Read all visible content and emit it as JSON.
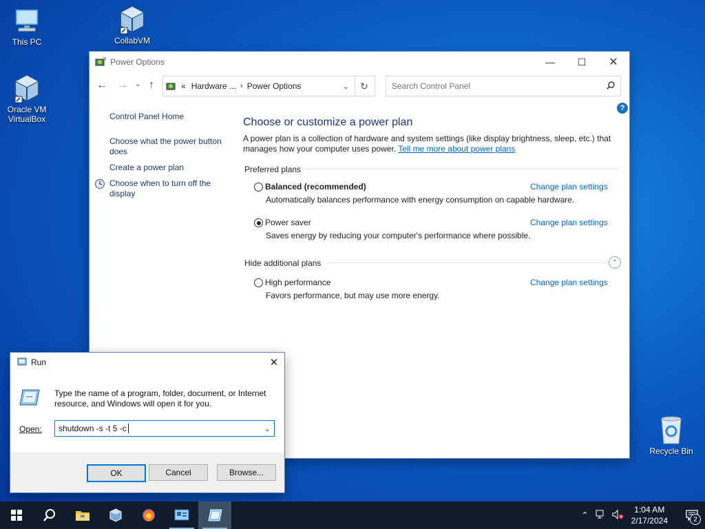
{
  "desktop": {
    "icons": [
      {
        "label": "This PC"
      },
      {
        "label": "CollabVM"
      },
      {
        "label": "Oracle VM VirtualBox"
      },
      {
        "label": "Recycle Bin"
      }
    ]
  },
  "power_window": {
    "title": "Power Options",
    "address": {
      "prefix": "«",
      "crumb1": "Hardware ...",
      "crumb2": "Power Options"
    },
    "search_placeholder": "Search Control Panel",
    "sidebar": {
      "home": "Control Panel Home",
      "items": [
        "Choose what the power button does",
        "Create a power plan",
        "Choose when to turn off the display"
      ]
    },
    "heading": "Choose or customize a power plan",
    "description": "A power plan is a collection of hardware and system settings (like display brightness, sleep, etc.) that manages how your computer uses power.",
    "tell_me_link": "Tell me more about power plans",
    "preferred_label": "Preferred plans",
    "hide_label": "Hide additional plans",
    "plans": [
      {
        "name": "Balanced (recommended)",
        "desc": "Automatically balances performance with energy consumption on capable hardware.",
        "selected": false,
        "link": "Change plan settings"
      },
      {
        "name": "Power saver",
        "desc": "Saves energy by reducing your computer's performance where possible.",
        "selected": true,
        "link": "Change plan settings"
      },
      {
        "name": "High performance",
        "desc": "Favors performance, but may use more energy.",
        "selected": false,
        "link": "Change plan settings"
      }
    ]
  },
  "run_dialog": {
    "title": "Run",
    "instructions": "Type the name of a program, folder, document, or Internet resource, and Windows will open it for you.",
    "open_label": "Open:",
    "open_value": "shutdown -s -t 5 -c",
    "ok": "OK",
    "cancel": "Cancel",
    "browse": "Browse..."
  },
  "taskbar": {
    "time": "1:04 AM",
    "date": "2/17/2024",
    "notification_count": "2"
  },
  "colors": {
    "accent": "#0078d7",
    "link": "#0066cc",
    "heading": "#1e3287",
    "taskbar": "#101c2c"
  }
}
